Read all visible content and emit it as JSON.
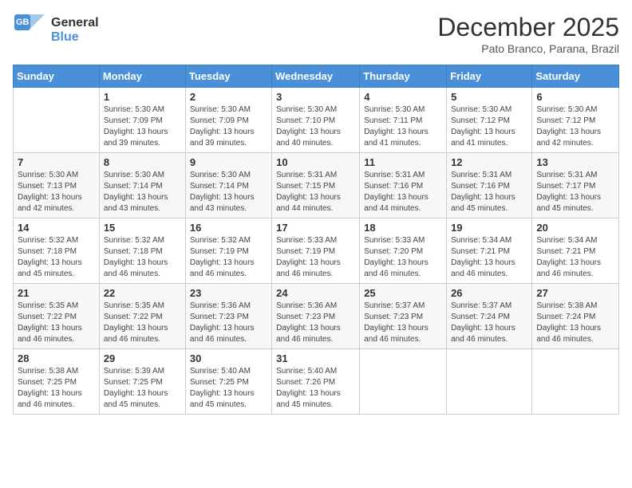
{
  "logo": {
    "general": "General",
    "blue": "Blue"
  },
  "header": {
    "month": "December 2025",
    "location": "Pato Branco, Parana, Brazil"
  },
  "weekdays": [
    "Sunday",
    "Monday",
    "Tuesday",
    "Wednesday",
    "Thursday",
    "Friday",
    "Saturday"
  ],
  "weeks": [
    [
      {
        "day": "",
        "info": ""
      },
      {
        "day": "1",
        "info": "Sunrise: 5:30 AM\nSunset: 7:09 PM\nDaylight: 13 hours\nand 39 minutes."
      },
      {
        "day": "2",
        "info": "Sunrise: 5:30 AM\nSunset: 7:09 PM\nDaylight: 13 hours\nand 39 minutes."
      },
      {
        "day": "3",
        "info": "Sunrise: 5:30 AM\nSunset: 7:10 PM\nDaylight: 13 hours\nand 40 minutes."
      },
      {
        "day": "4",
        "info": "Sunrise: 5:30 AM\nSunset: 7:11 PM\nDaylight: 13 hours\nand 41 minutes."
      },
      {
        "day": "5",
        "info": "Sunrise: 5:30 AM\nSunset: 7:12 PM\nDaylight: 13 hours\nand 41 minutes."
      },
      {
        "day": "6",
        "info": "Sunrise: 5:30 AM\nSunset: 7:12 PM\nDaylight: 13 hours\nand 42 minutes."
      }
    ],
    [
      {
        "day": "7",
        "info": "Sunrise: 5:30 AM\nSunset: 7:13 PM\nDaylight: 13 hours\nand 42 minutes."
      },
      {
        "day": "8",
        "info": "Sunrise: 5:30 AM\nSunset: 7:14 PM\nDaylight: 13 hours\nand 43 minutes."
      },
      {
        "day": "9",
        "info": "Sunrise: 5:30 AM\nSunset: 7:14 PM\nDaylight: 13 hours\nand 43 minutes."
      },
      {
        "day": "10",
        "info": "Sunrise: 5:31 AM\nSunset: 7:15 PM\nDaylight: 13 hours\nand 44 minutes."
      },
      {
        "day": "11",
        "info": "Sunrise: 5:31 AM\nSunset: 7:16 PM\nDaylight: 13 hours\nand 44 minutes."
      },
      {
        "day": "12",
        "info": "Sunrise: 5:31 AM\nSunset: 7:16 PM\nDaylight: 13 hours\nand 45 minutes."
      },
      {
        "day": "13",
        "info": "Sunrise: 5:31 AM\nSunset: 7:17 PM\nDaylight: 13 hours\nand 45 minutes."
      }
    ],
    [
      {
        "day": "14",
        "info": "Sunrise: 5:32 AM\nSunset: 7:18 PM\nDaylight: 13 hours\nand 45 minutes."
      },
      {
        "day": "15",
        "info": "Sunrise: 5:32 AM\nSunset: 7:18 PM\nDaylight: 13 hours\nand 46 minutes."
      },
      {
        "day": "16",
        "info": "Sunrise: 5:32 AM\nSunset: 7:19 PM\nDaylight: 13 hours\nand 46 minutes."
      },
      {
        "day": "17",
        "info": "Sunrise: 5:33 AM\nSunset: 7:19 PM\nDaylight: 13 hours\nand 46 minutes."
      },
      {
        "day": "18",
        "info": "Sunrise: 5:33 AM\nSunset: 7:20 PM\nDaylight: 13 hours\nand 46 minutes."
      },
      {
        "day": "19",
        "info": "Sunrise: 5:34 AM\nSunset: 7:21 PM\nDaylight: 13 hours\nand 46 minutes."
      },
      {
        "day": "20",
        "info": "Sunrise: 5:34 AM\nSunset: 7:21 PM\nDaylight: 13 hours\nand 46 minutes."
      }
    ],
    [
      {
        "day": "21",
        "info": "Sunrise: 5:35 AM\nSunset: 7:22 PM\nDaylight: 13 hours\nand 46 minutes."
      },
      {
        "day": "22",
        "info": "Sunrise: 5:35 AM\nSunset: 7:22 PM\nDaylight: 13 hours\nand 46 minutes."
      },
      {
        "day": "23",
        "info": "Sunrise: 5:36 AM\nSunset: 7:23 PM\nDaylight: 13 hours\nand 46 minutes."
      },
      {
        "day": "24",
        "info": "Sunrise: 5:36 AM\nSunset: 7:23 PM\nDaylight: 13 hours\nand 46 minutes."
      },
      {
        "day": "25",
        "info": "Sunrise: 5:37 AM\nSunset: 7:23 PM\nDaylight: 13 hours\nand 46 minutes."
      },
      {
        "day": "26",
        "info": "Sunrise: 5:37 AM\nSunset: 7:24 PM\nDaylight: 13 hours\nand 46 minutes."
      },
      {
        "day": "27",
        "info": "Sunrise: 5:38 AM\nSunset: 7:24 PM\nDaylight: 13 hours\nand 46 minutes."
      }
    ],
    [
      {
        "day": "28",
        "info": "Sunrise: 5:38 AM\nSunset: 7:25 PM\nDaylight: 13 hours\nand 46 minutes."
      },
      {
        "day": "29",
        "info": "Sunrise: 5:39 AM\nSunset: 7:25 PM\nDaylight: 13 hours\nand 45 minutes."
      },
      {
        "day": "30",
        "info": "Sunrise: 5:40 AM\nSunset: 7:25 PM\nDaylight: 13 hours\nand 45 minutes."
      },
      {
        "day": "31",
        "info": "Sunrise: 5:40 AM\nSunset: 7:26 PM\nDaylight: 13 hours\nand 45 minutes."
      },
      {
        "day": "",
        "info": ""
      },
      {
        "day": "",
        "info": ""
      },
      {
        "day": "",
        "info": ""
      }
    ]
  ]
}
